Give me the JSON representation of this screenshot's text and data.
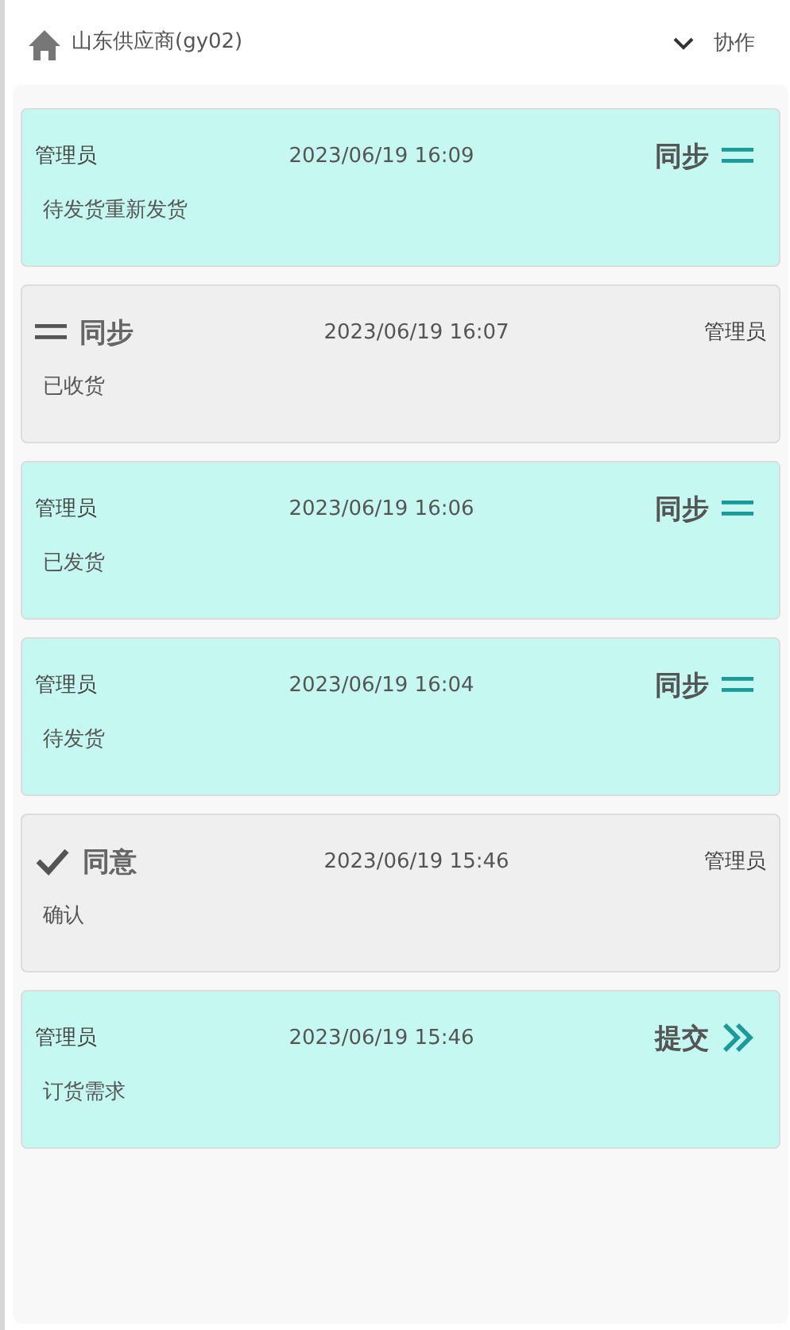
{
  "header": {
    "title": "山东供应商(gy02)",
    "menu_label": "协作"
  },
  "entries": [
    {
      "kind": "sync",
      "highlighted": true,
      "user": "管理员",
      "time": "2023/06/19 16:09",
      "action": "同步",
      "note": "待发货重新发货"
    },
    {
      "kind": "sync",
      "highlighted": false,
      "user": "管理员",
      "time": "2023/06/19 16:07",
      "action": "同步",
      "note": "已收货"
    },
    {
      "kind": "sync",
      "highlighted": true,
      "user": "管理员",
      "time": "2023/06/19 16:06",
      "action": "同步",
      "note": "已发货"
    },
    {
      "kind": "sync",
      "highlighted": true,
      "user": "管理员",
      "time": "2023/06/19 16:04",
      "action": "同步",
      "note": "待发货"
    },
    {
      "kind": "approve",
      "highlighted": false,
      "user": "管理员",
      "time": "2023/06/19 15:46",
      "action": "同意",
      "note": "确认"
    },
    {
      "kind": "submit",
      "highlighted": true,
      "user": "管理员",
      "time": "2023/06/19 15:46",
      "action": "提交",
      "note": "订货需求"
    }
  ]
}
